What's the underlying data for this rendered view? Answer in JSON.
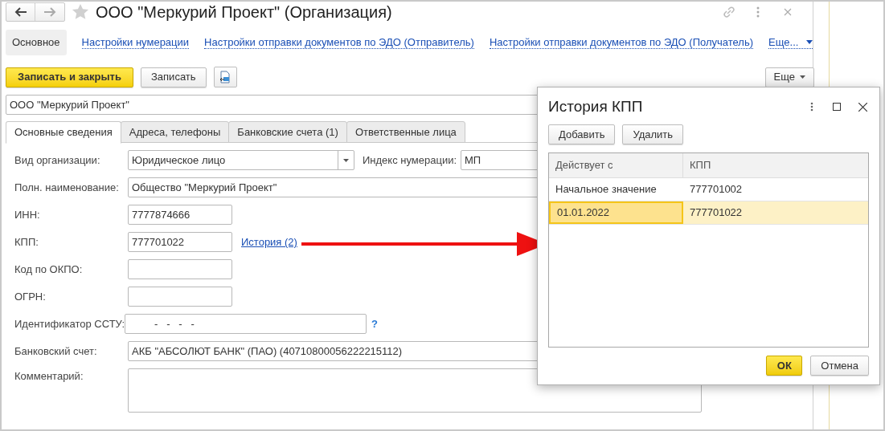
{
  "window": {
    "title": "ООО \"Меркурий Проект\" (Организация)"
  },
  "nav": [
    {
      "label": "Основное",
      "selected": true
    },
    {
      "label": "Настройки нумерации",
      "selected": false
    },
    {
      "label": "Настройки отправки документов по ЭДО (Отправитель)",
      "selected": false
    },
    {
      "label": "Настройки отправки документов по ЭДО (Получатель)",
      "selected": false
    }
  ],
  "nav_more": "Еще...",
  "toolbar": {
    "save_close": "Записать и закрыть",
    "save": "Записать",
    "more": "Еще"
  },
  "name_field": {
    "value": "ООО \"Меркурий Проект\""
  },
  "tabs": [
    {
      "label": "Основные сведения",
      "selected": true
    },
    {
      "label": "Адреса, телефоны",
      "selected": false
    },
    {
      "label": "Банковские счета (1)",
      "selected": false
    },
    {
      "label": "Ответственные лица",
      "selected": false
    }
  ],
  "form": {
    "org_type": {
      "label": "Вид организации:",
      "value": "Юридическое лицо"
    },
    "numbering_index": {
      "label": "Индекс нумерации:",
      "value": "МП"
    },
    "full_name": {
      "label": "Полн. наименование:",
      "value": "Общество \"Меркурий Проект\""
    },
    "inn": {
      "label": "ИНН:",
      "value": "7777874666"
    },
    "kpp": {
      "label": "КПП:",
      "value": "777701022",
      "link": "История (2)"
    },
    "okpo": {
      "label": "Код по ОКПО:"
    },
    "ogrn": {
      "label": "ОГРН:"
    },
    "sstu": {
      "label": "Идентификатор ССТУ:",
      "placeholder": "-   -   -   -",
      "help": "?"
    },
    "bank_account": {
      "label": "Банковский счет:",
      "value": "АКБ \"АБСОЛЮТ БАНК\" (ПАО) (40710800056222215112)"
    },
    "comment": {
      "label": "Комментарий:"
    }
  },
  "dialog": {
    "title": "История КПП",
    "add": "Добавить",
    "delete": "Удалить",
    "columns": [
      "Действует с",
      "КПП"
    ],
    "rows": [
      {
        "cells": [
          "Начальное значение",
          "777701002"
        ],
        "selected": false
      },
      {
        "cells": [
          "01.01.2022",
          "777701022"
        ],
        "selected": true
      }
    ],
    "ok": "ОК",
    "cancel": "Отмена"
  }
}
